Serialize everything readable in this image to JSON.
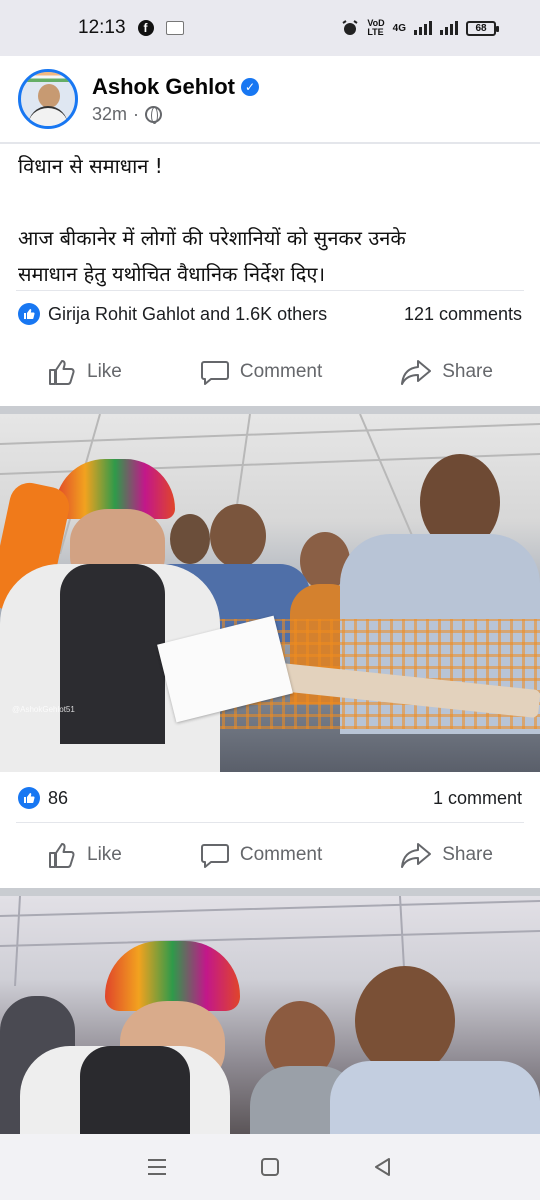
{
  "status_bar": {
    "time": "12:13",
    "network": "4G",
    "volte": "VoLTE",
    "battery": "68"
  },
  "post": {
    "author": "Ashok Gehlot",
    "time": "32m",
    "text_line1": "विधान से समाधान !",
    "text_line2": "आज बीकानेर में लोगों की परेशानियों को सुनकर उनके",
    "text_line3": "समाधान हेतु यथोचित वैधानिक निर्देश दिए।",
    "reactions_text": "Girija Rohit Gahlot and 1.6K others",
    "comments_text": "121 comments"
  },
  "actions": {
    "like": "Like",
    "comment": "Comment",
    "share": "Share"
  },
  "photo_item": {
    "watermark": "@AshokGehlot51",
    "reactions_count": "86",
    "comments_text": "1 comment"
  },
  "colors": {
    "brand_blue": "#1877f2",
    "muted_gray": "#65676b",
    "separator": "#c9ccd1"
  }
}
